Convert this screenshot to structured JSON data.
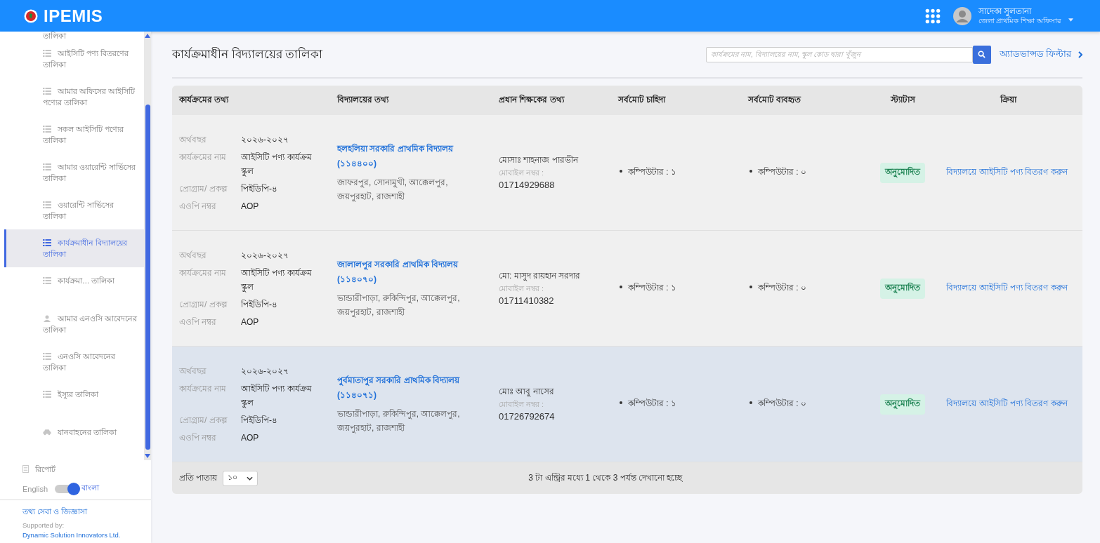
{
  "header": {
    "logo_text": "IPEMIS",
    "user_name": "সাদেকা সুলতানা",
    "user_role": "জেলা প্রাথমিক শিক্ষা অফিসার"
  },
  "sidebar": {
    "items": [
      {
        "label": "তালিকা",
        "kind": "cut",
        "selected": false
      },
      {
        "label": "আইসিটি পণ্য বিতরণের তালিকা",
        "kind": "list",
        "selected": false
      },
      {
        "label": "আমার অফিসের আইসিটি পণ্যের তালিকা",
        "kind": "list",
        "selected": false
      },
      {
        "label": "সকল আইসিটি পণ্যের তালিকা",
        "kind": "list",
        "selected": false
      },
      {
        "label": "আমার ওয়ারেন্টি সার্ভিসের তালিকা",
        "kind": "list",
        "selected": false
      },
      {
        "label": "ওয়ারেন্টি সার্ভিসের তালিকা",
        "kind": "list",
        "selected": false
      },
      {
        "label": "কার্যক্রমাধীন বিদ্যালয়ের তালিকা",
        "kind": "list",
        "selected": true
      },
      {
        "label": "কার্যক্রমা… তালিকা",
        "kind": "list",
        "selected": false
      },
      {
        "label": "আমার এনওসি আবেদনের তালিকা",
        "kind": "person",
        "selected": false
      },
      {
        "label": "এনওসি আবেদনের তালিকা",
        "kind": "list",
        "selected": false
      },
      {
        "label": "ইস্যুর তালিকা",
        "kind": "list",
        "selected": false
      },
      {
        "label": "যানবাহনের তালিকা",
        "kind": "car",
        "selected": false
      }
    ],
    "report": "রিপোর্ট",
    "language": {
      "left": "English",
      "right": "বাংলা",
      "on": true
    },
    "help_link": "তথ্য সেবা ও জিজ্ঞাসা",
    "supported_by": "Supported by:",
    "supporter": "Dynamic Solution Innovators Ltd."
  },
  "page": {
    "title": "কার্যক্রমাধীন বিদ্যালয়ের তালিকা",
    "search": {
      "placeholder": "কার্যক্রমের নাম, বিদ্যালয়ের নাম, স্কুল কোড দ্বারা খুঁজুন"
    },
    "advanced_filter": "অ্যাডভান্সড ফিল্টার"
  },
  "table": {
    "columns": [
      "কার্যক্রমের তথ্য",
      "বিদ্যালয়ের তথ্য",
      "প্রধান শিক্ষকের তথ্য",
      "সর্বমোট চাহিদা",
      "সর্বমোট ব্যবহৃত",
      "স্ট্যাটাস",
      "ক্রিয়া"
    ],
    "rows": [
      {
        "hovered": false,
        "program": [
          {
            "label": "অর্থবছর",
            "value": "২০২৬-২০২৭"
          },
          {
            "label": "কার্যক্রমের নাম",
            "value": "আইসিটি পণ্য কার্যক্রম স্কুল"
          },
          {
            "label": "প্রোগ্রাম/ প্রকল্প",
            "value": "পিইডিপি-৪"
          },
          {
            "label": "এওপি নম্বর",
            "value": "AOP"
          }
        ],
        "school": "হলহলিয়া সরকারি প্রাথমিক বিদ্যালয় (১১৪৪০০)",
        "address": "জাফরপুর, সোনামুখী, আক্কেলপুর, জয়পুরহাট, রাজশাহী",
        "head_name": "মোসাঃ শাহনাজ পারভীন",
        "mobile_label": "মোবাইল নম্বর :",
        "mobile": "01714929688",
        "demand": "কম্পিউটার : ১",
        "used": "কম্পিউটার : ০",
        "status": "অনুমোদিত",
        "action": "বিদ্যালয়ে আইসিটি পণ্য বিতরণ করুন"
      },
      {
        "hovered": false,
        "program": [
          {
            "label": "অর্থবছর",
            "value": "২০২৬-২০২৭"
          },
          {
            "label": "কার্যক্রমের নাম",
            "value": "আইসিটি পণ্য কার্যক্রম স্কুল"
          },
          {
            "label": "প্রোগ্রাম/ প্রকল্প",
            "value": "পিইডিপি-৪"
          },
          {
            "label": "এওপি নম্বর",
            "value": "AOP"
          }
        ],
        "school": "জালালপুর সরকারি প্রাথমিক বিদ্যালয় (১১৪০৭০)",
        "address": "ভান্ডারীপাড়া, রুকিন্দিপুর, আক্কেলপুর, জয়পুরহাট, রাজশাহী",
        "head_name": "মো: মাসুদ রায়হান সরদার",
        "mobile_label": "মোবাইল নম্বর :",
        "mobile": "01711410382",
        "demand": "কম্পিউটার : ১",
        "used": "কম্পিউটার : ০",
        "status": "অনুমোদিত",
        "action": "বিদ্যালয়ে আইসিটি পণ্য বিতরণ করুন"
      },
      {
        "hovered": true,
        "program": [
          {
            "label": "অর্থবছর",
            "value": "২০২৬-২০২৭"
          },
          {
            "label": "কার্যক্রমের নাম",
            "value": "আইসিটি পণ্য কার্যক্রম স্কুল"
          },
          {
            "label": "প্রোগ্রাম/ প্রকল্প",
            "value": "পিইডিপি-৪"
          },
          {
            "label": "এওপি নম্বর",
            "value": "AOP"
          }
        ],
        "school": "পুর্বমাতাপুর সরকারি প্রাথমিক বিদ্যালয় (১১৪০৭১)",
        "address": "ভান্ডারীপাড়া, রুকিন্দিপুর, আক্কেলপুর, জয়পুরহাট, রাজশাহী",
        "head_name": "মোঃ আবু নাসের",
        "mobile_label": "মোবাইল নম্বর :",
        "mobile": "01726792674",
        "demand": "কম্পিউটার : ১",
        "used": "কম্পিউটার : ০",
        "status": "অনুমোদিত",
        "action": "বিদ্যালয়ে আইসিটি পণ্য বিতরণ করুন"
      }
    ]
  },
  "pagination": {
    "per_page_label": "প্রতি পাতায়",
    "per_page": "১০",
    "info": "3 টা এন্ট্রির মধ্যে 1 থেকে 3 পর্যন্ত দেখানো হচ্ছে"
  }
}
